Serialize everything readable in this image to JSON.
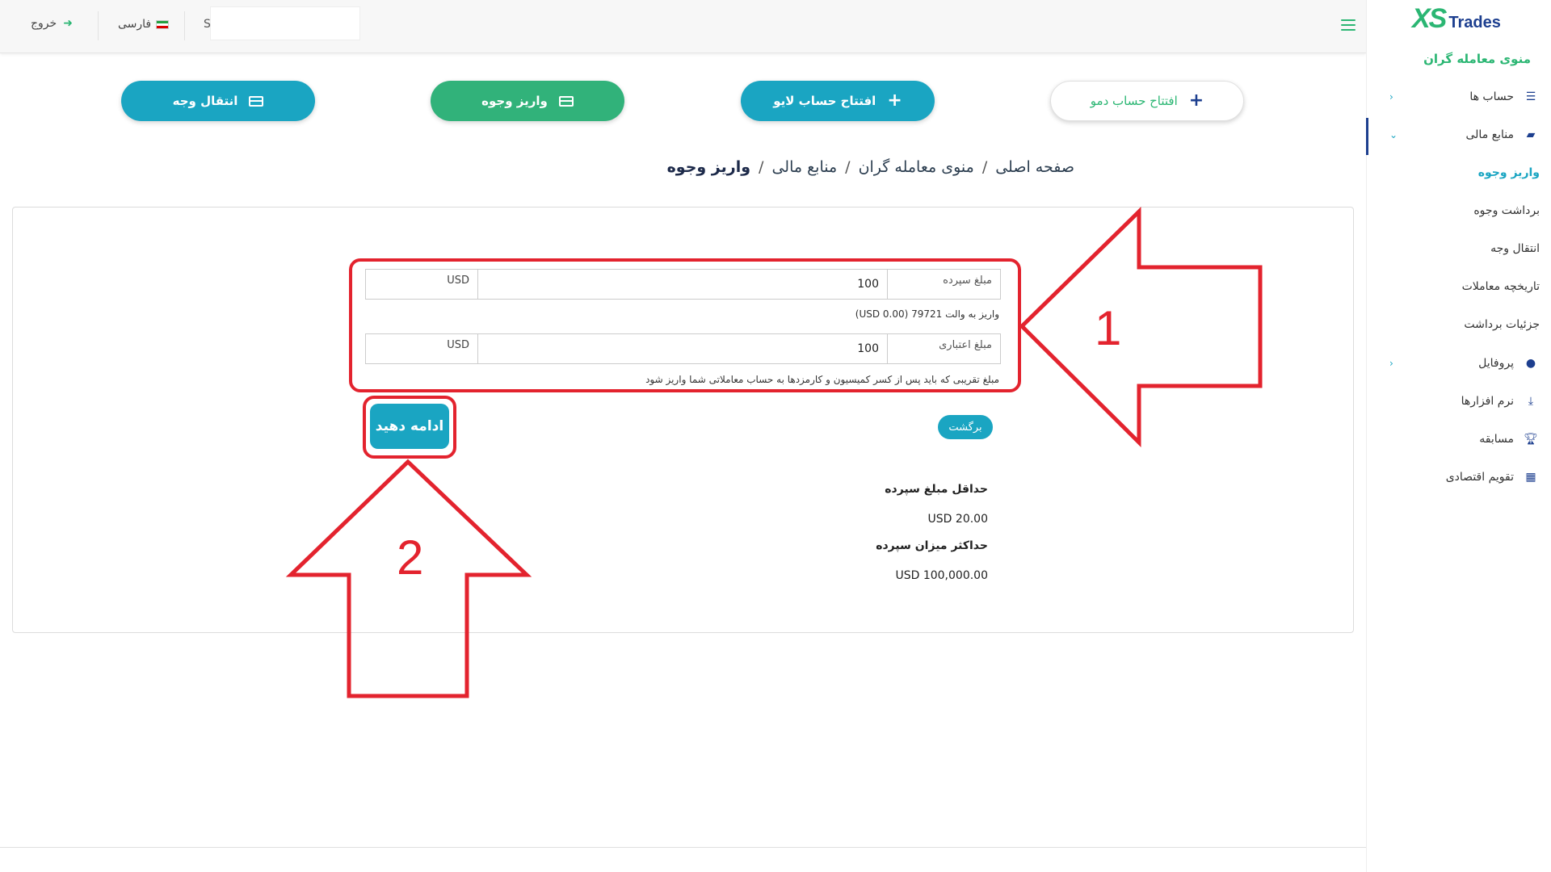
{
  "header": {
    "user_initial": "S",
    "language_label": "فارسی",
    "logout_label": "خروج"
  },
  "logo": {
    "part1": "XS",
    "part2": "Trades"
  },
  "sidebar": {
    "menu_title": "منوی معامله گران",
    "items": [
      {
        "label": "حساب ها",
        "icon": "list-icon"
      },
      {
        "label": "منابع مالی",
        "icon": "wallet-icon"
      },
      {
        "label": "پروفایل",
        "icon": "user-icon"
      },
      {
        "label": "نرم افزارها",
        "icon": "download-icon"
      },
      {
        "label": "مسابقه",
        "icon": "trophy-icon"
      },
      {
        "label": "تقویم اقتصادی",
        "icon": "calendar-icon"
      }
    ],
    "sub_items": [
      {
        "label": "واریز وجوه"
      },
      {
        "label": "برداشت وجوه"
      },
      {
        "label": "انتقال وجه"
      },
      {
        "label": "تاریخچه معاملات"
      },
      {
        "label": "جزئیات برداشت"
      }
    ]
  },
  "actions": {
    "demo": "افتتاح حساب دمو",
    "live": "افتتاح حساب لایو",
    "deposit": "واریز وجوه",
    "transfer": "انتقال وجه"
  },
  "breadcrumb": {
    "home": "صفحه اصلی",
    "traders": "منوی معامله گران",
    "finance": "منابع مالی",
    "current": "واریز وجوه"
  },
  "form": {
    "deposit_label": "مبلغ سپرده",
    "deposit_value": "100",
    "deposit_currency": "USD",
    "wallet_note": "واریز به والت 79721 (USD 0.00)",
    "credit_label": "مبلغ اعتباری",
    "credit_value": "100",
    "credit_currency": "USD",
    "credit_note": "مبلغ تقریبی که باید پس از کسر کمیسیون و کارمزدها به حساب معاملاتی شما واریز شود",
    "continue_label": "ادامه دهید",
    "back_label": "برگشت"
  },
  "limits": {
    "min_title": "حداقل مبلغ سپرده",
    "min_value": "USD 20.00",
    "max_title": "حداکثر میزان سپرده",
    "max_value": "USD 100,000.00"
  },
  "annotations": {
    "arrow1_number": "1",
    "arrow2_number": "2"
  },
  "colors": {
    "teal": "#1aa5c2",
    "green": "#31b27a",
    "brand_green": "#2bb673",
    "navy": "#1d3f8f",
    "annotation_red": "#e3232e"
  }
}
